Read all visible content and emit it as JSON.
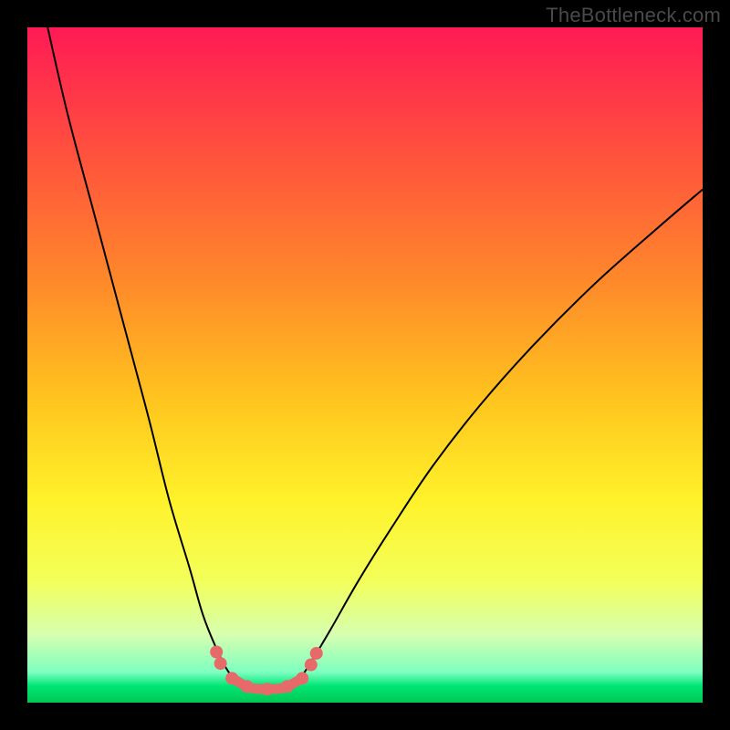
{
  "watermark": "TheBottleneck.com",
  "colors": {
    "frame": "#000000",
    "curve_stroke": "#000000",
    "marker_fill": "#e66a6a",
    "basin_stroke": "#e66a6a",
    "gradient_stops": [
      {
        "offset": 0.0,
        "color": "#ff1a55"
      },
      {
        "offset": 0.18,
        "color": "#ff4f3e"
      },
      {
        "offset": 0.38,
        "color": "#ff8a2a"
      },
      {
        "offset": 0.55,
        "color": "#ffc41e"
      },
      {
        "offset": 0.7,
        "color": "#fff22a"
      },
      {
        "offset": 0.82,
        "color": "#f3ff5a"
      },
      {
        "offset": 0.9,
        "color": "#d6ffb0"
      },
      {
        "offset": 0.955,
        "color": "#7dffc0"
      },
      {
        "offset": 0.975,
        "color": "#00e676"
      },
      {
        "offset": 1.0,
        "color": "#00c853"
      }
    ]
  },
  "chart_data": {
    "type": "line",
    "title": "",
    "xlabel": "",
    "ylabel": "",
    "xlim": [
      0,
      100
    ],
    "ylim": [
      0,
      100
    ],
    "grid": false,
    "legend": false,
    "annotations": [
      "TheBottleneck.com"
    ],
    "series": [
      {
        "name": "left-branch",
        "x": [
          3,
          6,
          10,
          14,
          18,
          21,
          24,
          26,
          28,
          29.5,
          31
        ],
        "y": [
          100,
          87,
          72,
          57,
          42,
          30,
          20,
          13,
          8,
          5,
          3.2
        ]
      },
      {
        "name": "right-branch",
        "x": [
          40,
          42,
          45,
          49,
          54,
          60,
          67,
          75,
          84,
          93,
          100
        ],
        "y": [
          3.2,
          6,
          11,
          18,
          26,
          35,
          44,
          53,
          62,
          70,
          76
        ]
      },
      {
        "name": "basin",
        "x": [
          31,
          33,
          35.5,
          38,
          40
        ],
        "y": [
          3.2,
          2.2,
          2.0,
          2.2,
          3.2
        ]
      }
    ],
    "markers": [
      {
        "x": 28.0,
        "y": 7.5
      },
      {
        "x": 28.6,
        "y": 5.8
      },
      {
        "x": 30.3,
        "y": 3.6
      },
      {
        "x": 32.5,
        "y": 2.4
      },
      {
        "x": 35.5,
        "y": 2.0
      },
      {
        "x": 38.5,
        "y": 2.4
      },
      {
        "x": 40.7,
        "y": 3.6
      },
      {
        "x": 42.0,
        "y": 5.6
      },
      {
        "x": 42.8,
        "y": 7.3
      }
    ]
  }
}
